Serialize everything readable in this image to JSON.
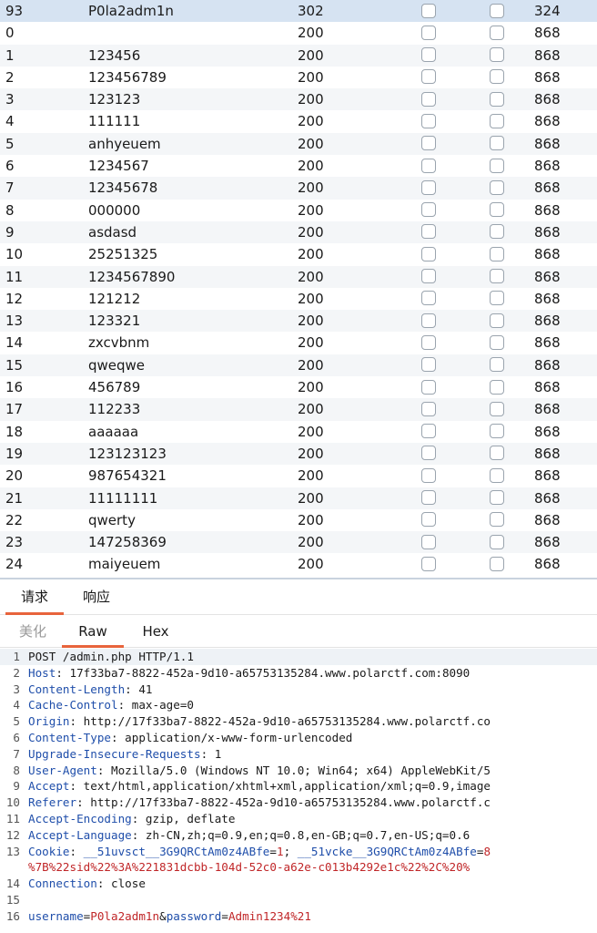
{
  "results": {
    "rows": [
      {
        "num": "93",
        "payload": "P0la2adm1n",
        "status": "302",
        "length": "324",
        "selected": true
      },
      {
        "num": "0",
        "payload": "",
        "status": "200",
        "length": "868"
      },
      {
        "num": "1",
        "payload": "123456",
        "status": "200",
        "length": "868"
      },
      {
        "num": "2",
        "payload": "123456789",
        "status": "200",
        "length": "868"
      },
      {
        "num": "3",
        "payload": "123123",
        "status": "200",
        "length": "868"
      },
      {
        "num": "4",
        "payload": "111111",
        "status": "200",
        "length": "868"
      },
      {
        "num": "5",
        "payload": "anhyeuem",
        "status": "200",
        "length": "868"
      },
      {
        "num": "6",
        "payload": "1234567",
        "status": "200",
        "length": "868"
      },
      {
        "num": "7",
        "payload": "12345678",
        "status": "200",
        "length": "868"
      },
      {
        "num": "8",
        "payload": "000000",
        "status": "200",
        "length": "868"
      },
      {
        "num": "9",
        "payload": "asdasd",
        "status": "200",
        "length": "868"
      },
      {
        "num": "10",
        "payload": "25251325",
        "status": "200",
        "length": "868"
      },
      {
        "num": "11",
        "payload": "1234567890",
        "status": "200",
        "length": "868"
      },
      {
        "num": "12",
        "payload": "121212",
        "status": "200",
        "length": "868"
      },
      {
        "num": "13",
        "payload": "123321",
        "status": "200",
        "length": "868"
      },
      {
        "num": "14",
        "payload": "zxcvbnm",
        "status": "200",
        "length": "868"
      },
      {
        "num": "15",
        "payload": "qweqwe",
        "status": "200",
        "length": "868"
      },
      {
        "num": "16",
        "payload": "456789",
        "status": "200",
        "length": "868"
      },
      {
        "num": "17",
        "payload": "112233",
        "status": "200",
        "length": "868"
      },
      {
        "num": "18",
        "payload": "aaaaaa",
        "status": "200",
        "length": "868"
      },
      {
        "num": "19",
        "payload": "123123123",
        "status": "200",
        "length": "868"
      },
      {
        "num": "20",
        "payload": "987654321",
        "status": "200",
        "length": "868"
      },
      {
        "num": "21",
        "payload": "11111111",
        "status": "200",
        "length": "868"
      },
      {
        "num": "22",
        "payload": "qwerty",
        "status": "200",
        "length": "868"
      },
      {
        "num": "23",
        "payload": "147258369",
        "status": "200",
        "length": "868"
      },
      {
        "num": "24",
        "payload": "maiyeuem",
        "status": "200",
        "length": "868"
      }
    ]
  },
  "tabs": {
    "request": "请求",
    "response": "响应"
  },
  "subtabs": {
    "pretty": "美化",
    "raw": "Raw",
    "hex": "Hex"
  },
  "request": {
    "lines": [
      {
        "no": "1",
        "parts": [
          {
            "t": "POST /admin.php HTTP/1.1",
            "c": "v"
          }
        ]
      },
      {
        "no": "2",
        "parts": [
          {
            "t": "Host",
            "c": "k"
          },
          {
            "t": ": 17f33ba7-8822-452a-9d10-a65753135284.www.polarctf.com:8090",
            "c": "v"
          }
        ]
      },
      {
        "no": "3",
        "parts": [
          {
            "t": "Content-Length",
            "c": "k"
          },
          {
            "t": ": 41",
            "c": "v"
          }
        ]
      },
      {
        "no": "4",
        "parts": [
          {
            "t": "Cache-Control",
            "c": "k"
          },
          {
            "t": ": max-age=0",
            "c": "v"
          }
        ]
      },
      {
        "no": "5",
        "parts": [
          {
            "t": "Origin",
            "c": "k"
          },
          {
            "t": ": http://17f33ba7-8822-452a-9d10-a65753135284.www.polarctf.co",
            "c": "v"
          }
        ]
      },
      {
        "no": "6",
        "parts": [
          {
            "t": "Content-Type",
            "c": "k"
          },
          {
            "t": ": application/x-www-form-urlencoded",
            "c": "v"
          }
        ]
      },
      {
        "no": "7",
        "parts": [
          {
            "t": "Upgrade-Insecure-Requests",
            "c": "k"
          },
          {
            "t": ": 1",
            "c": "v"
          }
        ]
      },
      {
        "no": "8",
        "parts": [
          {
            "t": "User-Agent",
            "c": "k"
          },
          {
            "t": ": Mozilla/5.0 (Windows NT 10.0; Win64; x64) AppleWebKit/5",
            "c": "v"
          }
        ]
      },
      {
        "no": "9",
        "parts": [
          {
            "t": "Accept",
            "c": "k"
          },
          {
            "t": ": text/html,application/xhtml+xml,application/xml;q=0.9,image",
            "c": "v"
          }
        ]
      },
      {
        "no": "10",
        "parts": [
          {
            "t": "Referer",
            "c": "k"
          },
          {
            "t": ": http://17f33ba7-8822-452a-9d10-a65753135284.www.polarctf.c",
            "c": "v"
          }
        ]
      },
      {
        "no": "11",
        "parts": [
          {
            "t": "Accept-Encoding",
            "c": "k"
          },
          {
            "t": ": gzip, deflate",
            "c": "v"
          }
        ]
      },
      {
        "no": "12",
        "parts": [
          {
            "t": "Accept-Language",
            "c": "k"
          },
          {
            "t": ": zh-CN,zh;q=0.9,en;q=0.8,en-GB;q=0.7,en-US;q=0.6",
            "c": "v"
          }
        ]
      },
      {
        "no": "13",
        "parts": [
          {
            "t": "Cookie",
            "c": "k"
          },
          {
            "t": ": ",
            "c": "v"
          },
          {
            "t": "__51uvsct__3G9QRCtAm0z4ABfe",
            "c": "k"
          },
          {
            "t": "=",
            "c": "v"
          },
          {
            "t": "1",
            "c": "r"
          },
          {
            "t": "; ",
            "c": "v"
          },
          {
            "t": "__51vcke__3G9QRCtAm0z4ABfe",
            "c": "k"
          },
          {
            "t": "=",
            "c": "v"
          },
          {
            "t": "8",
            "c": "r"
          }
        ]
      },
      {
        "no": "",
        "parts": [
          {
            "t": "%7B%22sid%22%3A%221831dcbb-104d-52c0-a62e-c013b4292e1c%22%2C%20%",
            "c": "r"
          }
        ]
      },
      {
        "no": "14",
        "parts": [
          {
            "t": "Connection",
            "c": "k"
          },
          {
            "t": ": close",
            "c": "v"
          }
        ]
      },
      {
        "no": "15",
        "parts": [
          {
            "t": "",
            "c": "v"
          }
        ]
      },
      {
        "no": "16",
        "parts": [
          {
            "t": "username",
            "c": "k"
          },
          {
            "t": "=",
            "c": "v"
          },
          {
            "t": "P0la2adm1n",
            "c": "r"
          },
          {
            "t": "&",
            "c": "v"
          },
          {
            "t": "password",
            "c": "k"
          },
          {
            "t": "=",
            "c": "v"
          },
          {
            "t": "Admin1234%21",
            "c": "r"
          }
        ]
      }
    ]
  }
}
